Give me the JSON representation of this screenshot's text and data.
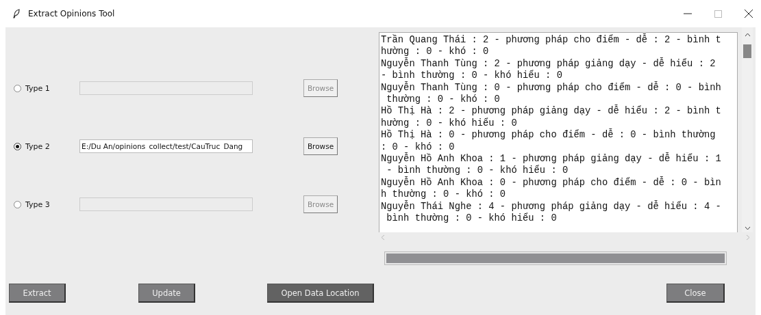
{
  "window": {
    "title": "Extract Opinions Tool"
  },
  "types": [
    {
      "label": "Type 1",
      "selected": false,
      "disabled": true
    },
    {
      "label": "Type 2",
      "selected": true,
      "path": "E:/Du An/opinions_collect/test/CauTruc_Dang",
      "disabled": false
    },
    {
      "label": "Type 3",
      "selected": false,
      "disabled": true
    }
  ],
  "browse_label": [
    "Browse",
    "Browse",
    "Browse"
  ],
  "output_lines": [
    "Trần Quang Thái : 2 - phương pháp cho điểm - dễ : 2 - bình t",
    "hường : 0 - khó : 0",
    "Nguyễn Thanh Tùng : 2 - phương pháp giảng dạy - dễ hiểu : 2",
    "- bình thường : 0 - khó hiểu : 0",
    "Nguyễn Thanh Tùng : 0 - phương pháp cho điểm - dễ : 0 - bình",
    " thường : 0 - khó : 0",
    "Hồ Thị Hà : 2 - phương pháp giảng dạy - dễ hiểu : 2 - bình t",
    "hường : 0 - khó hiểu : 0",
    "Hồ Thị Hà : 0 - phương pháp cho điểm - dễ : 0 - bình thường",
    ": 0 - khó : 0",
    "Nguyễn Hồ Anh Khoa : 1 - phương pháp giảng dạy - dễ hiểu : 1",
    " - bình thường : 0 - khó hiểu : 0",
    "Nguyễn Hồ Anh Khoa : 0 - phương pháp cho điểm - dễ : 0 - bìn",
    "h thường : 0 - khó : 0",
    "Nguyễn Thái Nghe : 4 - phương pháp giảng dạy - dễ hiểu : 4 -",
    " bình thường : 0 - khó hiểu : 0"
  ],
  "progress": {
    "level": 1
  },
  "buttons": [
    {
      "label": "Extract",
      "kind": "normal"
    },
    {
      "label": "Update",
      "kind": "normal"
    },
    {
      "label": "Open Data Location",
      "kind": "dark"
    }
  ],
  "close_button": {
    "label": "Close"
  }
}
